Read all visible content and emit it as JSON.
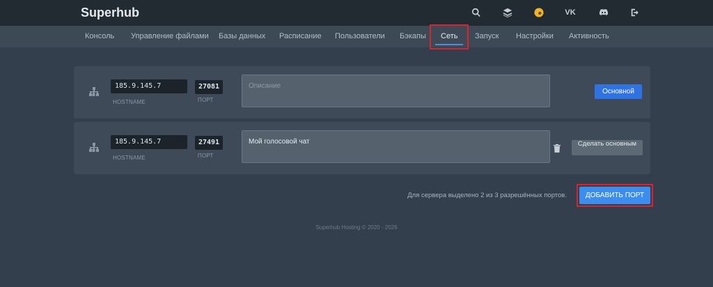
{
  "app": {
    "brand": "Superhub"
  },
  "topbar": {
    "icons": [
      "search-icon",
      "layers-icon",
      "user-avatar-icon",
      "vk-icon",
      "discord-icon",
      "logout-icon"
    ],
    "vk_label": "VK"
  },
  "nav": {
    "items": [
      {
        "label": "Консоль"
      },
      {
        "label": "Управление файлами"
      },
      {
        "label": "Базы данных"
      },
      {
        "label": "Расписание"
      },
      {
        "label": "Пользователи"
      },
      {
        "label": "Бэкапы"
      },
      {
        "label": "Сеть"
      },
      {
        "label": "Запуск"
      },
      {
        "label": "Настройки"
      },
      {
        "label": "Активность"
      }
    ],
    "active": "Сеть"
  },
  "ports": [
    {
      "hostname": "185.9.145.7",
      "hostname_label": "HOSTNAME",
      "port": "27081",
      "port_label": "ПОРТ",
      "description": "",
      "description_placeholder": "Описание",
      "action_label": "Основной"
    },
    {
      "hostname": "185.9.145.7",
      "hostname_label": "HOSTNAME",
      "port": "27491",
      "port_label": "ПОРТ",
      "description": "Мой голосовой чат",
      "action_label": "Сделать основным"
    }
  ],
  "allocation": {
    "text": "Для сервера выделено 2 из 3 разрешённых портов.",
    "add_button": "ДОБАВИТЬ ПОРТ"
  },
  "footer": {
    "text": "Superhub Hosting © 2020 - 2026"
  },
  "colors": {
    "accent": "#2f73e3",
    "add_button": "#3b8ef0",
    "highlight": "#d9232e"
  }
}
